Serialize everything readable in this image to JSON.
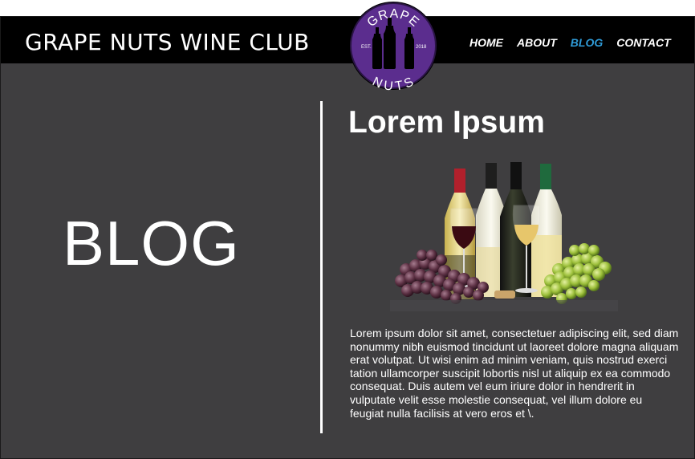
{
  "site": {
    "title": "GRAPE NUTS WINE CLUB",
    "logo": {
      "top_text": "GRAPE",
      "bottom_text": "NUTS",
      "left_text": "EST.",
      "right_text": "2018"
    }
  },
  "nav": {
    "items": [
      {
        "label": "HOME",
        "active": false
      },
      {
        "label": "ABOUT",
        "active": false
      },
      {
        "label": "BLOG",
        "active": true
      },
      {
        "label": "CONTACT",
        "active": false
      }
    ]
  },
  "page": {
    "heading": "BLOG"
  },
  "post": {
    "title": "Lorem Ipsum",
    "body": "Lorem ipsum dolor sit amet, consectetuer adipiscing elit, sed diam nonummy nibh euismod tincidunt ut laoreet dolore magna aliquam erat volutpat. Ut wisi enim ad minim veniam, quis nostrud exerci tation ullamcorper suscipit lobortis nisl ut aliquip ex ea commodo consequat. Duis autem vel eum iriure dolor in hendrerit in vulputate velit esse molestie consequat, vel illum dolore eu feugiat nulla facilisis at vero eros et \\."
  },
  "colors": {
    "background": "#3f3e40",
    "header": "#000000",
    "accent": "#2f9ad6",
    "logo_purple": "#5b2d8e"
  }
}
